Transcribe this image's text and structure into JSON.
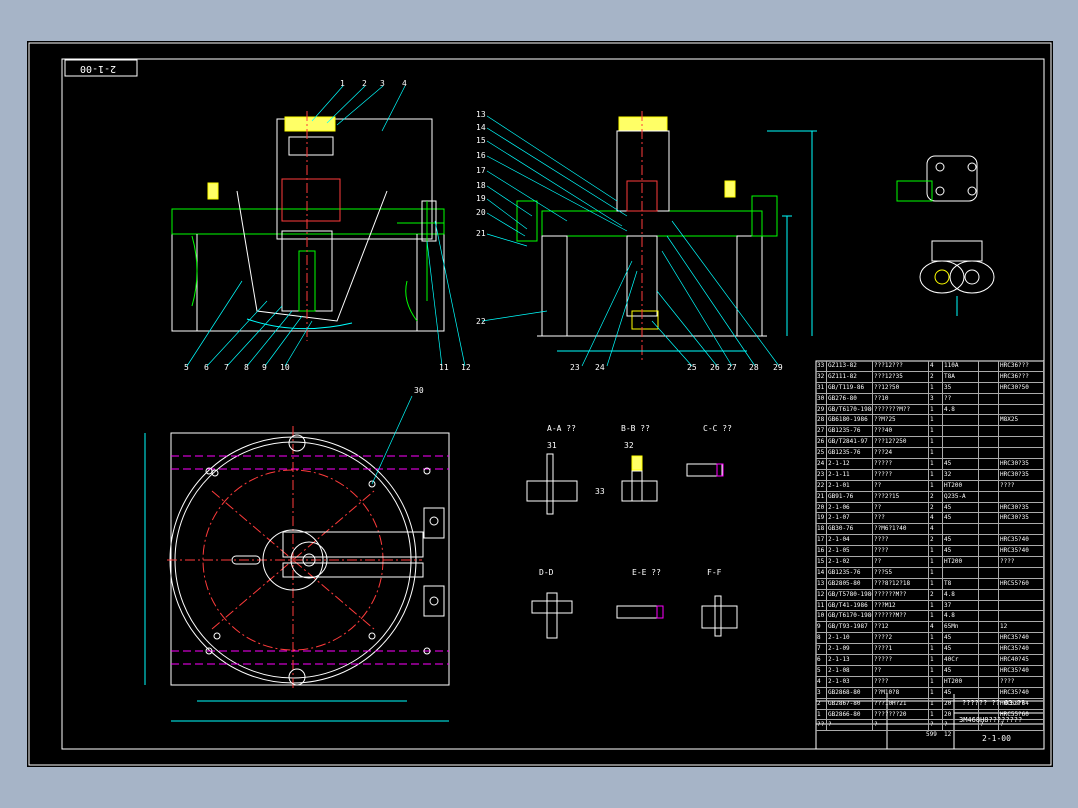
{
  "drawing": {
    "number": "2-1-00",
    "corner_code": "2-1-00",
    "title_block": {
      "line1": "?????? ?? 03.??",
      "line2": "3M468H8????????",
      "drawing_no": "2-1-00",
      "small": [
        "599",
        "12"
      ]
    },
    "section_labels": [
      "A-A ??",
      "B-B ??",
      "C-C ??",
      "D-D",
      "E-E ??",
      "F-F"
    ],
    "front_view_callouts": [
      "1",
      "2",
      "3",
      "4",
      "5",
      "6",
      "7",
      "8",
      "9",
      "10",
      "11",
      "12"
    ],
    "side_view_callouts": [
      "13",
      "14",
      "15",
      "16",
      "17",
      "18",
      "19",
      "20",
      "21",
      "22",
      "23",
      "24",
      "25",
      "26",
      "27",
      "28",
      "29"
    ],
    "plan_view_callouts": [
      "30"
    ],
    "section_callouts": [
      "31",
      "32",
      "33"
    ]
  },
  "parts_list": [
    [
      "33",
      "GZ113-82",
      "???12???",
      "4",
      "110A",
      "",
      "HRC36???"
    ],
    [
      "32",
      "GZ111-82",
      "???12?35",
      "2",
      "T8A",
      "",
      "HRC36???"
    ],
    [
      "31",
      "GB/T119-86",
      "??12?50",
      "1",
      "35",
      "",
      "HRC30?50"
    ],
    [
      "30",
      "GB276-80",
      "??10",
      "3",
      "??",
      "",
      ""
    ],
    [
      "29",
      "GB/T6170-1986",
      "???????M??",
      "1",
      "4.8",
      "",
      ""
    ],
    [
      "28",
      "GB6180-1986",
      "??M?25",
      "1",
      "",
      "",
      "M8X25"
    ],
    [
      "27",
      "GB1235-76",
      "???40",
      "1",
      "",
      "",
      ""
    ],
    [
      "26",
      "GB/T2841-97",
      "???12?250",
      "1",
      "",
      "",
      ""
    ],
    [
      "25",
      "GB1235-76",
      "???24",
      "1",
      "",
      "",
      ""
    ],
    [
      "24",
      "2-1-12",
      "?????",
      "1",
      "45",
      "",
      "HRC30?35"
    ],
    [
      "23",
      "2-1-11",
      "?????",
      "1",
      "32",
      "",
      "HRC30?35"
    ],
    [
      "22",
      "2-1-01",
      "??",
      "1",
      "HT200",
      "",
      "????"
    ],
    [
      "21",
      "GB91-76",
      "???2?15",
      "2",
      "Q235-A",
      "",
      ""
    ],
    [
      "20",
      "2-1-06",
      "??",
      "2",
      "45",
      "",
      "HRC30?35"
    ],
    [
      "19",
      "2-1-07",
      "???",
      "4",
      "45",
      "",
      "HRC30?35"
    ],
    [
      "18",
      "GB30-76",
      "??M6?1?40",
      "4",
      "",
      "",
      ""
    ],
    [
      "17",
      "2-1-04",
      "????",
      "2",
      "45",
      "",
      "HRC35?40"
    ],
    [
      "16",
      "2-1-05",
      "????",
      "1",
      "45",
      "",
      "HRC35?40"
    ],
    [
      "15",
      "2-1-02",
      "??",
      "1",
      "HT200",
      "",
      "????"
    ],
    [
      "14",
      "GB1235-76",
      "???55",
      "1",
      "",
      "",
      ""
    ],
    [
      "13",
      "GB2805-80",
      "???8?12?18",
      "1",
      "T8",
      "",
      "HRC55?60"
    ],
    [
      "12",
      "GB/T5780-1986",
      "??????M??",
      "2",
      "4.8",
      "",
      ""
    ],
    [
      "11",
      "GB/T41-1986",
      "???M12",
      "1",
      "37",
      "",
      ""
    ],
    [
      "10",
      "GB/T6170-1986",
      "??????M??",
      "1",
      "4.8",
      "",
      ""
    ],
    [
      "9",
      "GB/T93-1987",
      "??12",
      "4",
      "65Mn",
      "",
      "12"
    ],
    [
      "8",
      "2-1-10",
      "????2",
      "1",
      "45",
      "",
      "HRC35?40"
    ],
    [
      "7",
      "2-1-09",
      "????1",
      "1",
      "45",
      "",
      "HRC35?40"
    ],
    [
      "6",
      "2-1-13",
      "?????",
      "1",
      "40Cr",
      "",
      "HRC40?45"
    ],
    [
      "5",
      "2-1-08",
      "??",
      "1",
      "45",
      "",
      "HRC35?40"
    ],
    [
      "4",
      "2-1-03",
      "????",
      "1",
      "HT200",
      "",
      "????"
    ],
    [
      "3",
      "GB2868-80",
      "??M10?8",
      "1",
      "45",
      "",
      "HRC35?40"
    ],
    [
      "2",
      "GB2867-80",
      "???10H?21",
      "1",
      "20",
      "",
      "HRC58?64"
    ],
    [
      "1",
      "GB2866-80",
      "???????20",
      "1",
      "20",
      "",
      "HRC55?60"
    ]
  ],
  "parts_header": [
    "??",
    "?",
    "?",
    "?",
    "?",
    "?",
    "?"
  ],
  "colors": {
    "line": "#ffffff",
    "outline": "#00ff00",
    "center": "#ff3b3b",
    "phantom": "#ff00ff",
    "dim": "#00ffff",
    "callout": "#ffff00",
    "frame_bg": "#a6b4c7"
  }
}
